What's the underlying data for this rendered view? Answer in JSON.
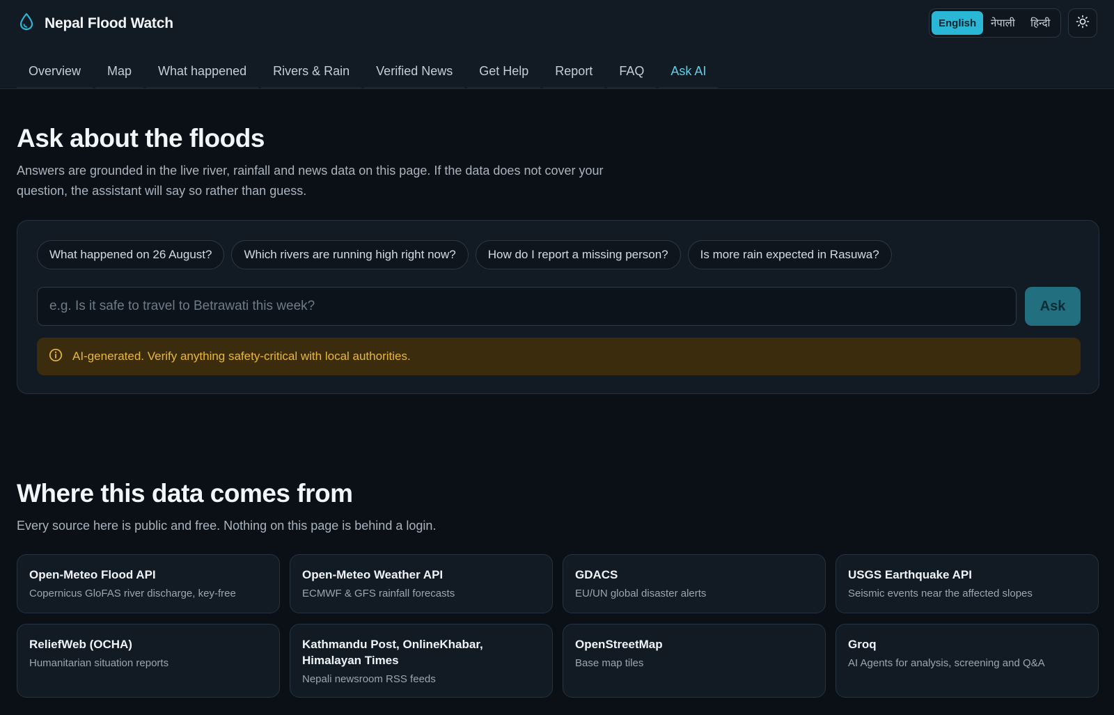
{
  "app": {
    "title": "Nepal Flood Watch",
    "accent": "#2ab7d6"
  },
  "languages": [
    {
      "label": "English",
      "active": true
    },
    {
      "label": "नेपाली",
      "active": false
    },
    {
      "label": "हिन्दी",
      "active": false
    }
  ],
  "theme_toggle_icon": "sun-icon",
  "nav": [
    {
      "label": "Overview"
    },
    {
      "label": "Map"
    },
    {
      "label": "What happened"
    },
    {
      "label": "Rivers & Rain"
    },
    {
      "label": "Verified News"
    },
    {
      "label": "Get Help"
    },
    {
      "label": "Report"
    },
    {
      "label": "FAQ"
    },
    {
      "label": "Ask AI",
      "active": true
    }
  ],
  "ask": {
    "title": "Ask about the floods",
    "subtitle_line1": "Answers are grounded in the live river, rainfall and news data on this page. If the data does not cover your",
    "subtitle_line2": "question, the assistant will say so rather than guess.",
    "suggestions": [
      "What happened on 26 August?",
      "Which rivers are running high right now?",
      "How do I report a missing person?",
      "Is more rain expected in Rasuwa?"
    ],
    "input_placeholder": "e.g. Is it safe to travel to Betrawati this week?",
    "input_value": "",
    "button_label": "Ask",
    "warning": "AI-generated. Verify anything safety-critical with local authorities.",
    "warning_color": "#e8b73a"
  },
  "sources_section": {
    "title": "Where this data comes from",
    "subtitle": "Every source here is public and free. Nothing on this page is behind a login.",
    "sources": [
      {
        "name": "Open-Meteo Flood API",
        "desc": "Copernicus GloFAS river discharge, key-free"
      },
      {
        "name": "Open-Meteo Weather API",
        "desc": "ECMWF & GFS rainfall forecasts"
      },
      {
        "name": "GDACS",
        "desc": "EU/UN global disaster alerts"
      },
      {
        "name": "USGS Earthquake API",
        "desc": "Seismic events near the affected slopes"
      },
      {
        "name": "ReliefWeb (OCHA)",
        "desc": "Humanitarian situation reports"
      },
      {
        "name": "Kathmandu Post, OnlineKhabar, Himalayan Times",
        "desc": "Nepali newsroom RSS feeds"
      },
      {
        "name": "OpenStreetMap",
        "desc": "Base map tiles"
      },
      {
        "name": "Groq",
        "desc": "AI Agents for analysis, screening and Q&A"
      }
    ]
  }
}
